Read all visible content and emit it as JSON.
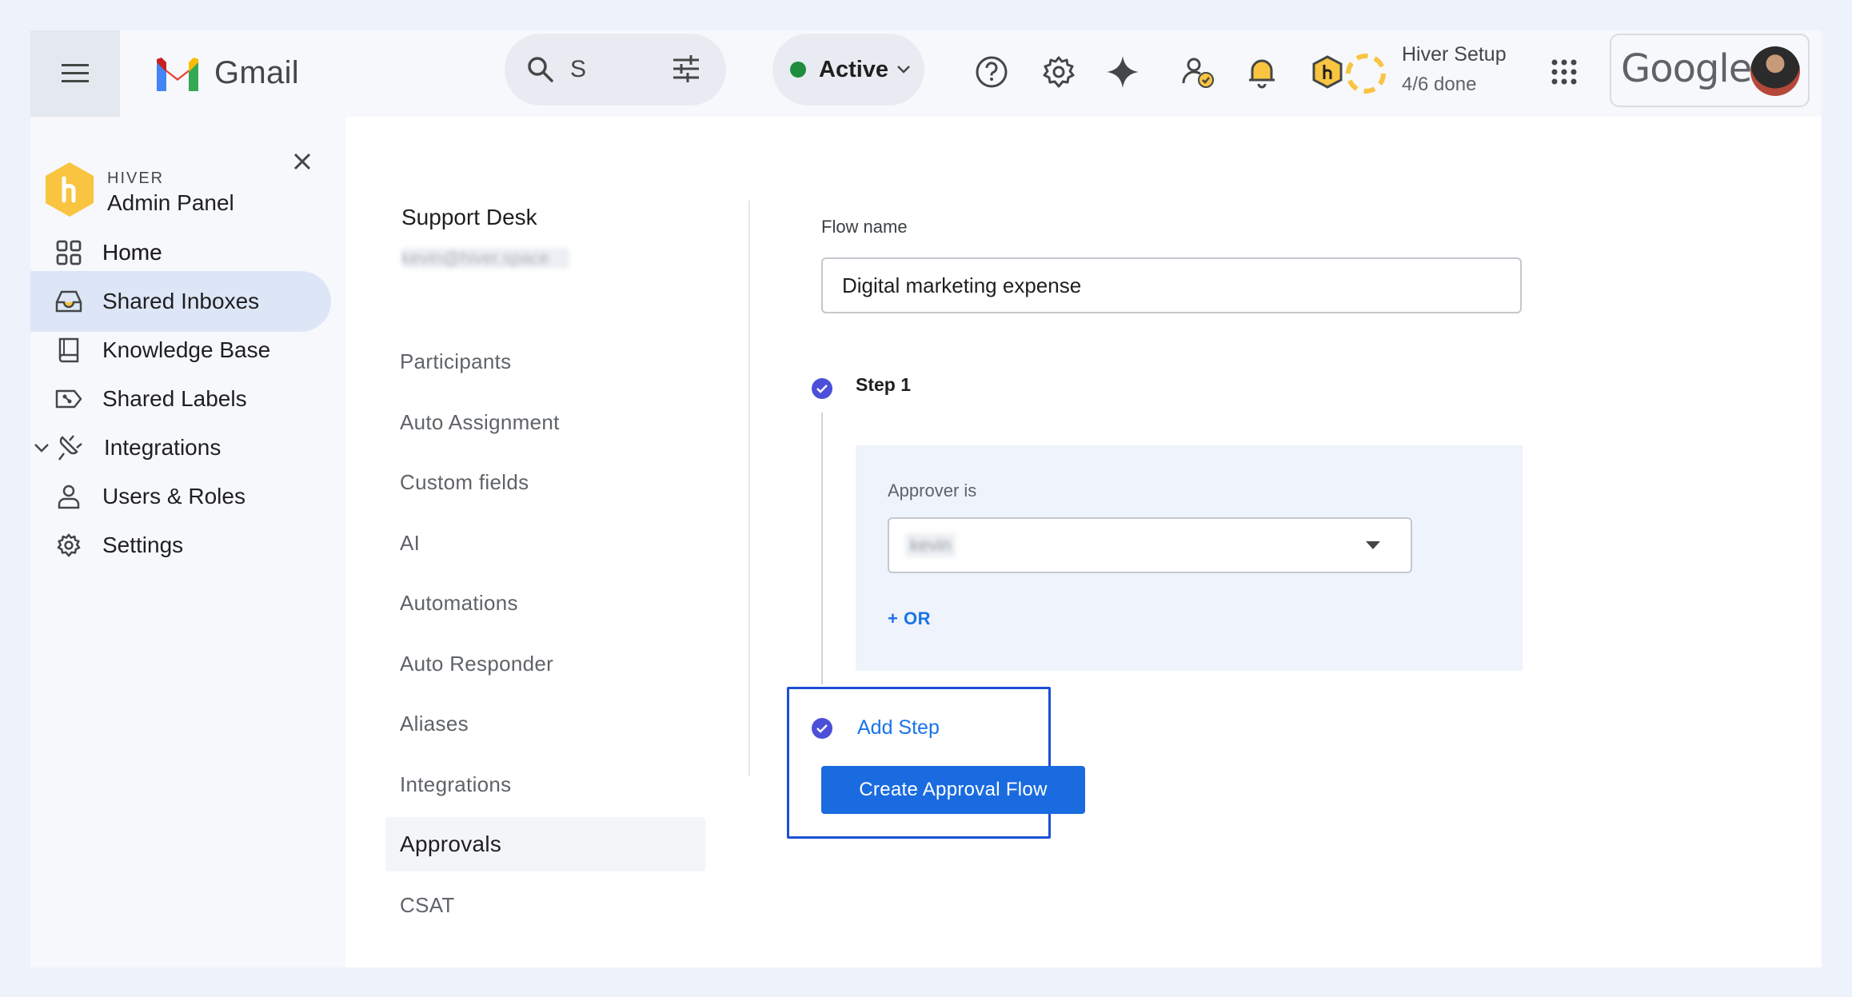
{
  "topbar": {
    "app_name": "Gmail",
    "search_value": "S",
    "status_label": "Active",
    "setup_title": "Hiver Setup",
    "setup_progress": "4/6 done",
    "setup_progress_fraction": 0.667,
    "account_brand": "Google"
  },
  "sidebar": {
    "brand": "HIVER",
    "title": "Admin Panel",
    "items": [
      {
        "label": "Home",
        "icon": "grid-icon"
      },
      {
        "label": "Shared Inboxes",
        "icon": "inbox-icon",
        "active": true
      },
      {
        "label": "Knowledge Base",
        "icon": "book-icon"
      },
      {
        "label": "Shared Labels",
        "icon": "label-icon"
      },
      {
        "label": "Integrations",
        "icon": "plug-icon",
        "expandable": true
      },
      {
        "label": "Users & Roles",
        "icon": "person-icon"
      },
      {
        "label": "Settings",
        "icon": "gear-icon"
      }
    ]
  },
  "inbox": {
    "name": "Support Desk",
    "email": "kevin@hiver.space",
    "menu": [
      "Participants",
      "Auto Assignment",
      "Custom fields",
      "AI",
      "Automations",
      "Auto Responder",
      "Aliases",
      "Integrations",
      "Approvals",
      "CSAT"
    ],
    "active_menu": "Approvals"
  },
  "flow": {
    "name_label": "Flow name",
    "name_value": "Digital marketing expense",
    "step_label": "Step 1",
    "approver_label": "Approver is",
    "approver_value": "kevin",
    "or_label": "+ OR",
    "add_step_label": "Add Step",
    "create_button_label": "Create Approval Flow"
  },
  "colors": {
    "accent": "#1a73e8",
    "button": "#1a6be0",
    "highlight_border": "#1b4fd6",
    "step_check": "#4c4fd8",
    "status_green": "#1e8e3e",
    "hiver_yellow": "#f9c440"
  }
}
